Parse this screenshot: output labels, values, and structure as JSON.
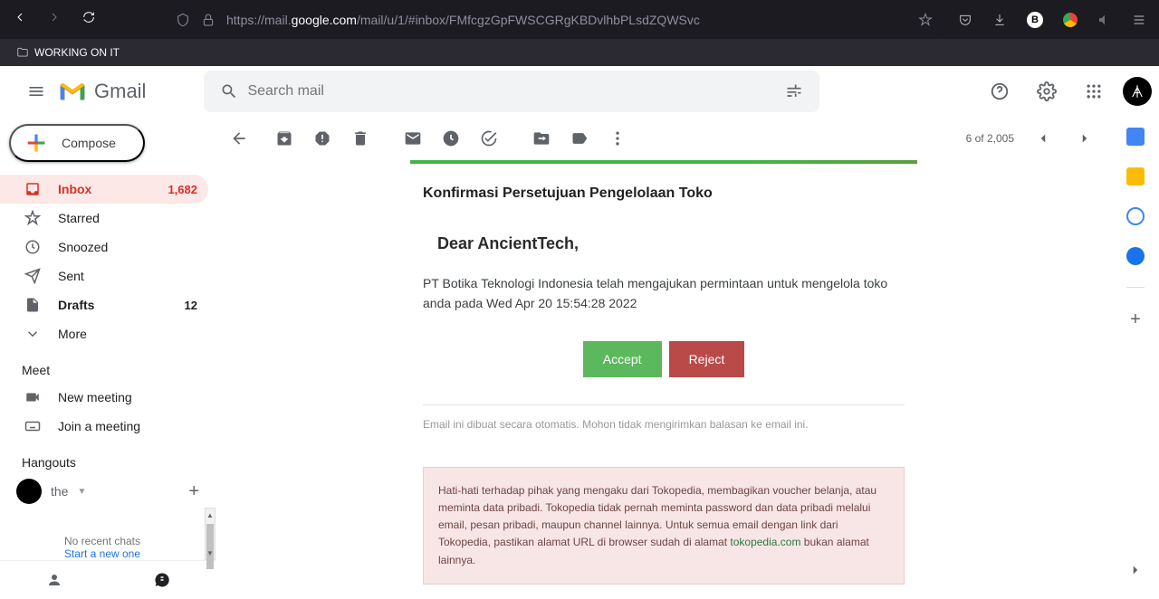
{
  "browser": {
    "url_prefix": "https://mail.",
    "url_domain": "google.com",
    "url_path": "/mail/u/1/#inbox/FMfcgzGpFWSCGRgKBDvlhbPLsdZQWSvc",
    "bookmark": "WORKING ON IT"
  },
  "header": {
    "app_name": "Gmail",
    "search_placeholder": "Search mail"
  },
  "compose": "Compose",
  "nav": {
    "inbox": "Inbox",
    "inbox_count": "1,682",
    "starred": "Starred",
    "snoozed": "Snoozed",
    "sent": "Sent",
    "drafts": "Drafts",
    "drafts_count": "12",
    "more": "More"
  },
  "meet": {
    "header": "Meet",
    "new_meeting": "New meeting",
    "join_meeting": "Join a meeting"
  },
  "hangouts": {
    "header": "Hangouts",
    "user": "the",
    "no_recent": "No recent chats",
    "start_new": "Start a new one"
  },
  "toolbar": {
    "position": "6 of 2,005"
  },
  "email": {
    "title": "Konfirmasi Persetujuan Pengelolaan Toko",
    "greeting": "Dear AncientTech,",
    "paragraph": "PT Botika Teknologi Indonesia telah mengajukan permintaan untuk mengelola toko anda pada Wed Apr 20 15:54:28 2022",
    "accept": "Accept",
    "reject": "Reject",
    "auto_msg": "Email ini dibuat secara otomatis. Mohon tidak mengirimkan balasan ke email ini.",
    "warning_1": "Hati-hati terhadap pihak yang mengaku dari Tokopedia, membagikan voucher belanja, atau meminta data pribadi. Tokopedia tidak pernah meminta password dan data pribadi melalui email, pesan pribadi, maupun channel lainnya. Untuk semua email dengan link dari Tokopedia, pastikan alamat URL di browser sudah di alamat ",
    "warning_link": "tokopedia.com",
    "warning_2": " bukan alamat lainnya."
  }
}
